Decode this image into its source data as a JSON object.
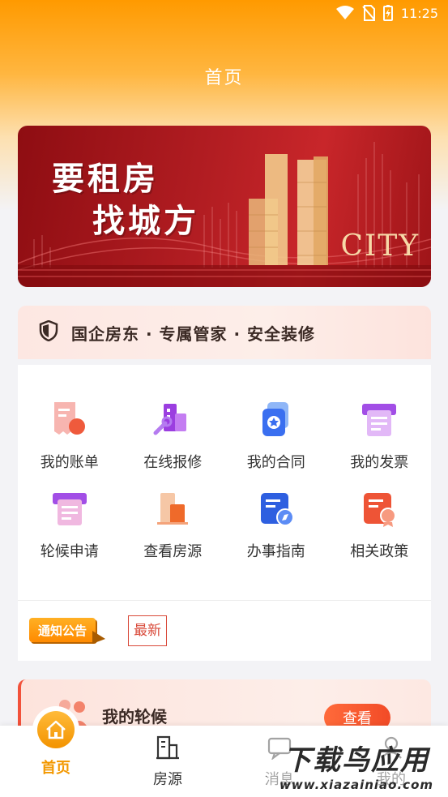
{
  "status_bar": {
    "time": "11:25",
    "icons": [
      "wifi-icon",
      "no-sim-icon",
      "battery-charging-icon"
    ]
  },
  "header": {
    "title": "首页"
  },
  "banner": {
    "slogan_line1": "要租房",
    "slogan_line2": "找城方",
    "city_text": "CITY"
  },
  "tagline": {
    "text": "国企房东 · 专属管家 · 安全装修",
    "icon": "shield-icon"
  },
  "menu": {
    "items": [
      {
        "label": "我的账单",
        "icon": "bill-icon"
      },
      {
        "label": "在线报修",
        "icon": "repair-icon"
      },
      {
        "label": "我的合同",
        "icon": "contract-icon"
      },
      {
        "label": "我的发票",
        "icon": "invoice-icon"
      },
      {
        "label": "轮候申请",
        "icon": "queue-apply-icon"
      },
      {
        "label": "查看房源",
        "icon": "housing-icon"
      },
      {
        "label": "办事指南",
        "icon": "guide-icon"
      },
      {
        "label": "相关政策",
        "icon": "policy-icon"
      }
    ]
  },
  "notice": {
    "tag": "通知公告",
    "latest": "最新"
  },
  "queue_card": {
    "title": "我的轮候",
    "button": "查看"
  },
  "tabbar": {
    "tabs": [
      {
        "label": "首页",
        "icon": "home-icon",
        "active": true
      },
      {
        "label": "房源",
        "icon": "building-icon",
        "active": false
      },
      {
        "label": "消息",
        "icon": "message-icon",
        "active": false
      },
      {
        "label": "我的",
        "icon": "user-icon",
        "active": false
      }
    ]
  },
  "watermark": {
    "line1": "下载鸟应用",
    "line2": "www.xiazainiao.com"
  },
  "colors": {
    "accent": "#f39800",
    "banner_red": "#b21d22",
    "text": "#333333"
  }
}
